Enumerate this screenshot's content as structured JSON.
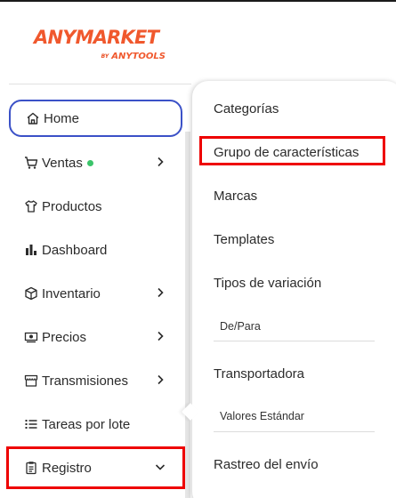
{
  "brand": {
    "name": "ANYMARKET",
    "by": "BY",
    "sub": "ANYTOOLS",
    "color": "#f0582d"
  },
  "sidebar": {
    "items": [
      {
        "label": "Home",
        "icon": "home-icon"
      },
      {
        "label": "Ventas",
        "icon": "cart-icon",
        "status_dot": "#3bc46a"
      },
      {
        "label": "Productos",
        "icon": "shirt-icon"
      },
      {
        "label": "Dashboard",
        "icon": "bar-chart-icon"
      },
      {
        "label": "Inventario",
        "icon": "box-icon"
      },
      {
        "label": "Precios",
        "icon": "money-icon"
      },
      {
        "label": "Transmisiones",
        "icon": "store-icon"
      },
      {
        "label": "Tareas por lote",
        "icon": "list-icon"
      },
      {
        "label": "Registro",
        "icon": "clipboard-icon"
      }
    ]
  },
  "submenu": {
    "items": [
      {
        "label": "Categorías"
      },
      {
        "label": "Grupo de características"
      },
      {
        "label": "Marcas"
      },
      {
        "label": "Templates"
      },
      {
        "label": "Tipos de variación"
      },
      {
        "label": "De/Para"
      },
      {
        "label": "Transportadora"
      },
      {
        "label": "Valores Estándar"
      },
      {
        "label": "Rastreo del envío"
      }
    ]
  },
  "colors": {
    "active_border": "#3b51c7",
    "highlight": "#ee0000"
  }
}
